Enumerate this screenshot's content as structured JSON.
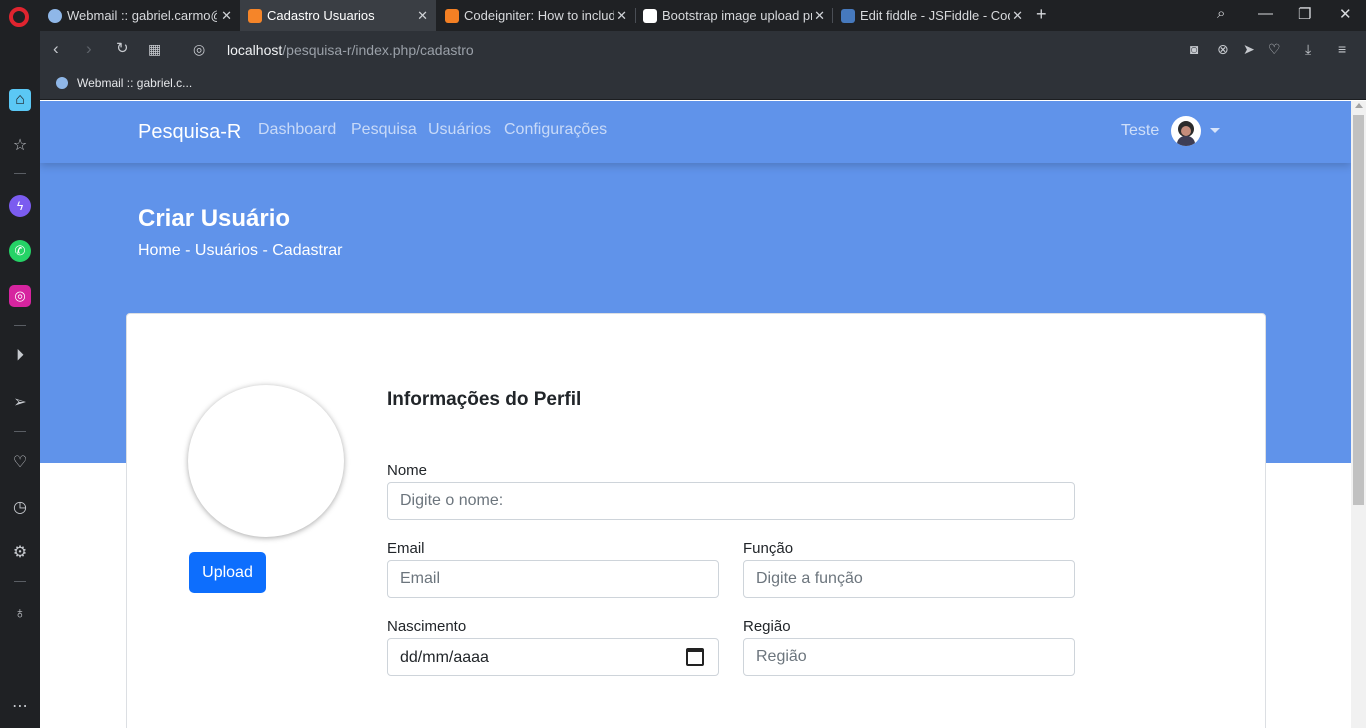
{
  "browser": {
    "tabs": [
      {
        "title": "Webmail :: gabriel.carmo@",
        "active": false,
        "favicon_color": "#8fb7e8"
      },
      {
        "title": "Cadastro Usuarios",
        "active": true,
        "favicon_color": "#f58529"
      },
      {
        "title": "Codeigniter: How to includ",
        "active": false,
        "favicon_color": "#f48024"
      },
      {
        "title": "Bootstrap image upload pr",
        "active": false,
        "favicon_color": "#ffffff"
      },
      {
        "title": "Edit fiddle - JSFiddle - Code",
        "active": false,
        "favicon_color": "#4679bd"
      }
    ],
    "url_host": "localhost",
    "url_path": "/pesquisa-r/index.php/cadastro",
    "bookmark": "Webmail :: gabriel.c..."
  },
  "navbar": {
    "brand": "Pesquisa-R",
    "links": [
      "Dashboard",
      "Pesquisa",
      "Usuários",
      "Configurações"
    ],
    "user": "Teste"
  },
  "header": {
    "title": "Criar Usuário",
    "breadcrumb": "Home - Usuários - Cadastrar"
  },
  "profile": {
    "upload_label": "Upload",
    "section_title": "Informações do Perfil"
  },
  "form": {
    "nome_label": "Nome",
    "nome_placeholder": "Digite o nome:",
    "email_label": "Email",
    "email_placeholder": "Email",
    "funcao_label": "Função",
    "funcao_placeholder": "Digite a função",
    "nascimento_label": "Nascimento",
    "nascimento_value": "dd/mm/aaaa",
    "regiao_label": "Região",
    "regiao_placeholder": "Região"
  },
  "colors": {
    "primary_bg": "#6093ea",
    "button": "#0d6efd"
  }
}
